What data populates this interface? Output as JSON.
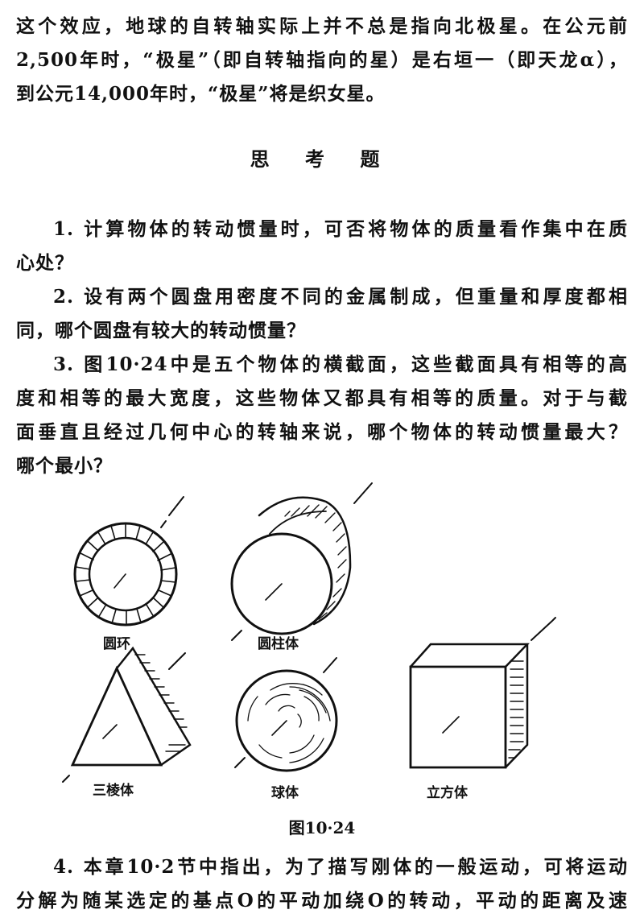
{
  "top_paragraph": {
    "lines": [
      "这个效应，地球的自转轴实际上并不总是指向北极星。在公元前",
      "2,500年时，“极星”（即自转轴指向的星）是右垣一（即天龙α），",
      "到公元14,000年时，“极星”将是织女星。"
    ]
  },
  "section_title": "思 考 题",
  "questions": [
    {
      "lines": [
        "1. 计算物体的转动惯量时，可否将物体的质量看作集中在质",
        "心处？"
      ]
    },
    {
      "lines": [
        "2. 设有两个圆盘用密度不同的金属制成，但重量和厚度都相",
        "同，哪个圆盘有较大的转动惯量？"
      ]
    },
    {
      "lines": [
        "3. 图10·24中是五个物体的横截面，这些截面具有相等的高",
        "度和相等的最大宽度，这些物体又都具有相等的质量。对于与截",
        "面垂直且经过几何中心的转轴来说，哪个物体的转动惯量最大？",
        "哪个最小？"
      ]
    }
  ],
  "figure": {
    "labels": {
      "ring": "圆环",
      "cylinder": "圆柱体",
      "prism": "三棱体",
      "sphere": "球体",
      "cube": "立方体"
    },
    "caption": "图10·24"
  },
  "question4": {
    "lines": [
      "4. 本章10·2节中指出，为了描写刚体的一般运动，可将运动",
      "分解为随某选定的基点O的平动加绕O的转动，平动的距离及速"
    ]
  }
}
